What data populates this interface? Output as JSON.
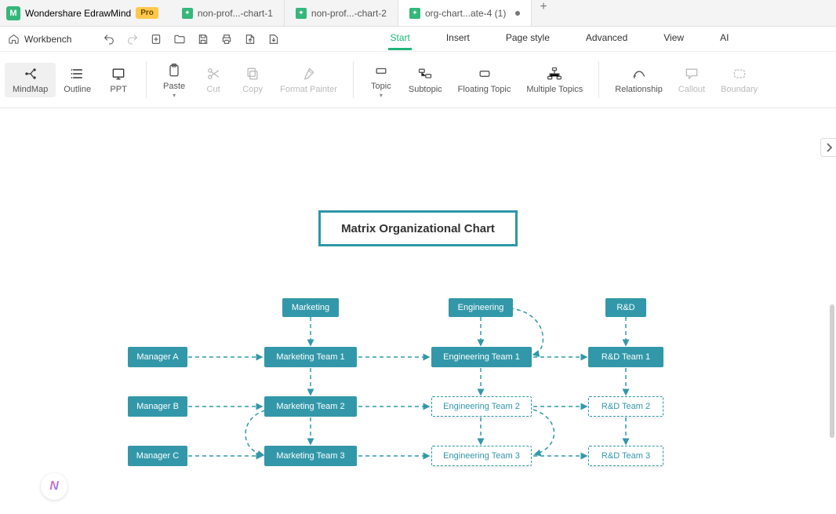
{
  "app": {
    "name": "Wondershare EdrawMind",
    "badge": "Pro"
  },
  "tabs": [
    {
      "label": "non-prof...-chart-1",
      "active": false
    },
    {
      "label": "non-prof...-chart-2",
      "active": false
    },
    {
      "label": "org-chart...ate-4 (1)",
      "active": true,
      "modified": true
    }
  ],
  "workbench_label": "Workbench",
  "menu": {
    "start": "Start",
    "insert": "Insert",
    "page_style": "Page style",
    "advanced": "Advanced",
    "view": "View",
    "ai": "AI"
  },
  "ribbon": {
    "mindmap": "MindMap",
    "outline": "Outline",
    "ppt": "PPT",
    "paste": "Paste",
    "cut": "Cut",
    "copy": "Copy",
    "format_painter": "Format Painter",
    "topic": "Topic",
    "subtopic": "Subtopic",
    "floating_topic": "Floating Topic",
    "multiple_topics": "Multiple Topics",
    "relationship": "Relationship",
    "callout": "Callout",
    "boundary": "Boundary"
  },
  "chart": {
    "title": "Matrix Organizational Chart",
    "departments": {
      "marketing": "Marketing",
      "engineering": "Engineering",
      "rd": "R&D"
    },
    "managers": {
      "a": "Manager A",
      "b": "Manager B",
      "c": "Manager C"
    },
    "teams": {
      "m1": "Marketing Team 1",
      "m2": "Marketing Team 2",
      "m3": "Marketing Team 3",
      "e1": "Engineering Team 1",
      "e2": "Engineering Team 2",
      "e3": "Engineering Team 3",
      "r1": "R&D Team 1",
      "r2": "R&D Team 2",
      "r3": "R&D Team 3"
    }
  }
}
